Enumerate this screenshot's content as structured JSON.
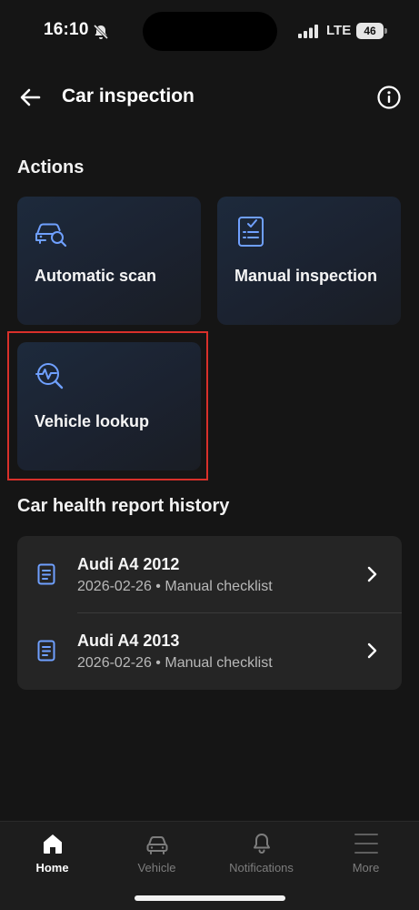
{
  "status_bar": {
    "time": "16:10",
    "network": "LTE",
    "battery": "46"
  },
  "header": {
    "title": "Car inspection"
  },
  "actions": {
    "section_title": "Actions",
    "items": [
      {
        "label": "Automatic scan",
        "icon": "car-search-icon"
      },
      {
        "label": "Manual inspection",
        "icon": "checklist-icon"
      },
      {
        "label": "Vehicle lookup",
        "icon": "diagnostic-search-icon"
      }
    ]
  },
  "history": {
    "section_title": "Car health report history",
    "items": [
      {
        "title": "Audi A4 2012",
        "date": "2026-02-26",
        "separator": "•",
        "type": "Manual checklist"
      },
      {
        "title": "Audi A4 2013",
        "date": "2026-02-26",
        "separator": "•",
        "type": "Manual checklist"
      }
    ]
  },
  "tabs": [
    {
      "label": "Home",
      "icon": "home-icon",
      "active": true
    },
    {
      "label": "Vehicle",
      "icon": "car-icon",
      "active": false
    },
    {
      "label": "Notifications",
      "icon": "bell-icon",
      "active": false
    },
    {
      "label": "More",
      "icon": "menu-icon",
      "active": false
    }
  ],
  "colors": {
    "background": "#151515",
    "accent": "#6fa0ff",
    "card": "#1d2a3c",
    "highlight": "#d9302a"
  }
}
